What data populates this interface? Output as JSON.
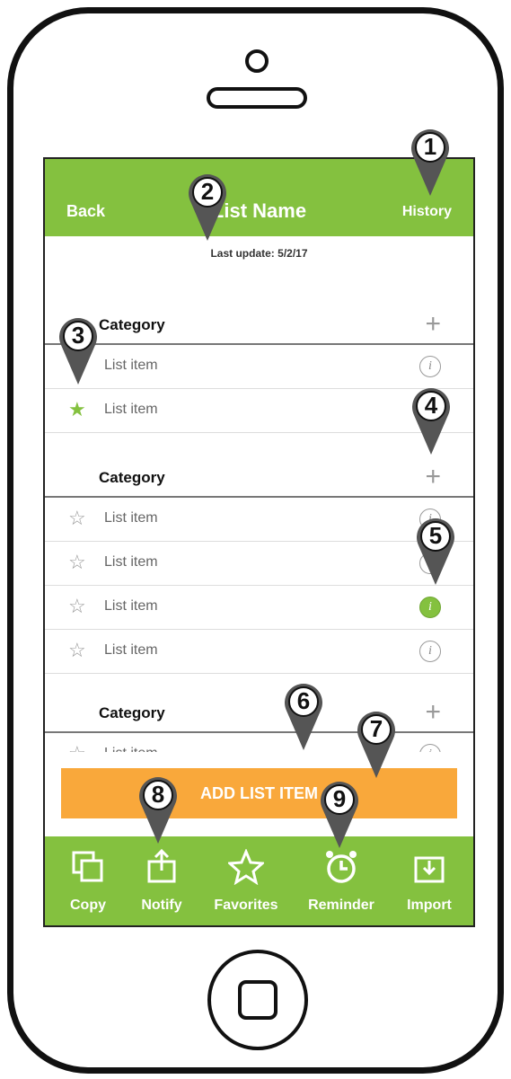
{
  "header": {
    "back_label": "Back",
    "title": "List Name",
    "history_label": "History",
    "last_update": "Last update: 5/2/17"
  },
  "categories": [
    {
      "label": "Category",
      "items": [
        {
          "label": "List item",
          "favorite": false,
          "star_visible": false,
          "info_active": false
        },
        {
          "label": "List item",
          "favorite": true,
          "star_visible": true,
          "info_active": false
        }
      ]
    },
    {
      "label": "Category",
      "items": [
        {
          "label": "List item",
          "favorite": false,
          "star_visible": true,
          "info_active": false
        },
        {
          "label": "List item",
          "favorite": false,
          "star_visible": true,
          "info_active": false
        },
        {
          "label": "List item",
          "favorite": false,
          "star_visible": true,
          "info_active": true
        },
        {
          "label": "List item",
          "favorite": false,
          "star_visible": true,
          "info_active": false
        }
      ]
    },
    {
      "label": "Category",
      "items": [
        {
          "label": "List item",
          "favorite": false,
          "star_visible": true,
          "info_active": false
        }
      ]
    }
  ],
  "add_button_label": "ADD LIST ITEM",
  "toolbar": {
    "items": [
      {
        "label": "Copy",
        "icon": "copy-icon"
      },
      {
        "label": "Notify",
        "icon": "share-icon"
      },
      {
        "label": "Favorites",
        "icon": "star-outline-icon"
      },
      {
        "label": "Reminder",
        "icon": "alarm-clock-icon"
      },
      {
        "label": "Import",
        "icon": "import-tray-icon"
      }
    ]
  },
  "callouts": [
    "1",
    "2",
    "3",
    "4",
    "5",
    "6",
    "7",
    "8",
    "9"
  ],
  "colors": {
    "accent_green": "#84c13f",
    "add_button_orange": "#f9a83b",
    "marker_dark": "#555555"
  }
}
